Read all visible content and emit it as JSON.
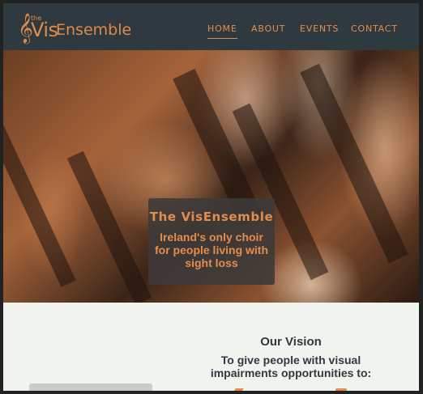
{
  "header": {
    "logo": {
      "the": "the",
      "vis": "Vis",
      "ensemble": "Ensemble"
    },
    "nav": [
      {
        "label": "HOME",
        "active": true
      },
      {
        "label": "ABOUT",
        "active": false
      },
      {
        "label": "EVENTS",
        "active": false
      },
      {
        "label": "CONTACT",
        "active": false
      }
    ]
  },
  "hero": {
    "title": "The VisEnsemble",
    "subtitle": "Ireland's only choir for people living with sight loss"
  },
  "vision": {
    "title": "Our Vision",
    "text": "To give people with visual impairments opportunities to:"
  },
  "colors": {
    "accent": "#e58c4d",
    "header_bg": "#2f3a40",
    "page_bg": "#f1f3ee"
  }
}
